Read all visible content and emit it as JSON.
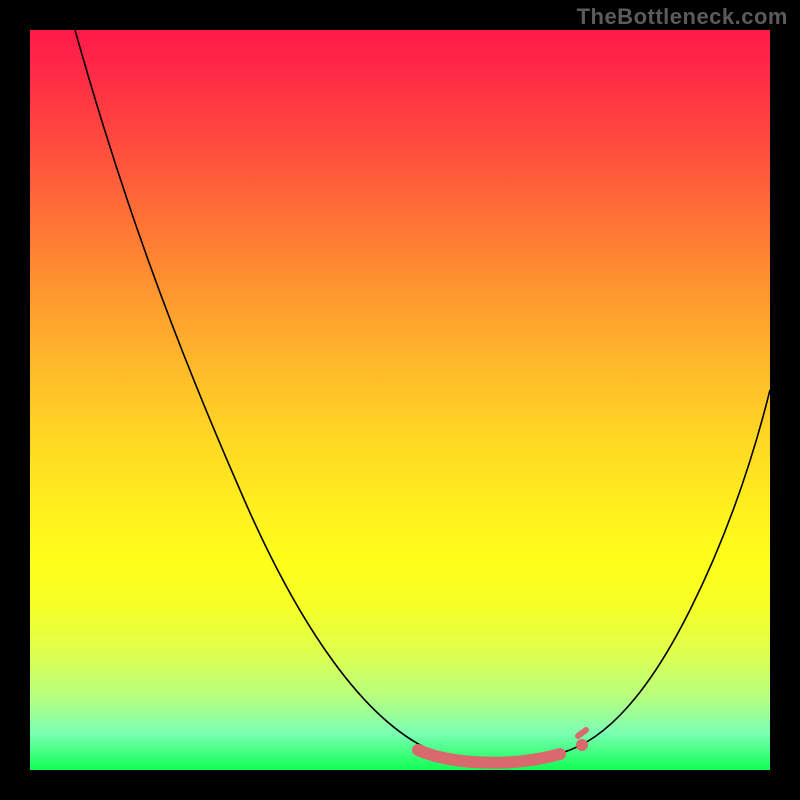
{
  "watermark": "TheBottleneck.com",
  "colors": {
    "gradient_top": "#ff1a49",
    "gradient_mid": "#ffe61e",
    "gradient_bottom": "#10ff52",
    "curve": "#000000",
    "marker": "#d86a6d",
    "frame": "#000000"
  },
  "chart_data": {
    "type": "line",
    "title": "",
    "xlabel": "",
    "ylabel": "",
    "xlim": [
      0,
      100
    ],
    "ylim": [
      0,
      100
    ],
    "series": [
      {
        "name": "bottleneck-curve",
        "x": [
          6,
          12,
          20,
          28,
          36,
          44,
          50,
          56,
          62,
          68,
          74,
          80,
          86,
          92,
          98,
          100
        ],
        "y": [
          100,
          82,
          65,
          50,
          38,
          25,
          15,
          7,
          2,
          0,
          0,
          2,
          8,
          20,
          38,
          52
        ]
      }
    ],
    "annotations": [
      {
        "name": "optimal-range",
        "x_start": 52,
        "x_end": 74,
        "y": 0,
        "color": "#d86a6d"
      }
    ],
    "legend": false,
    "grid": false
  }
}
